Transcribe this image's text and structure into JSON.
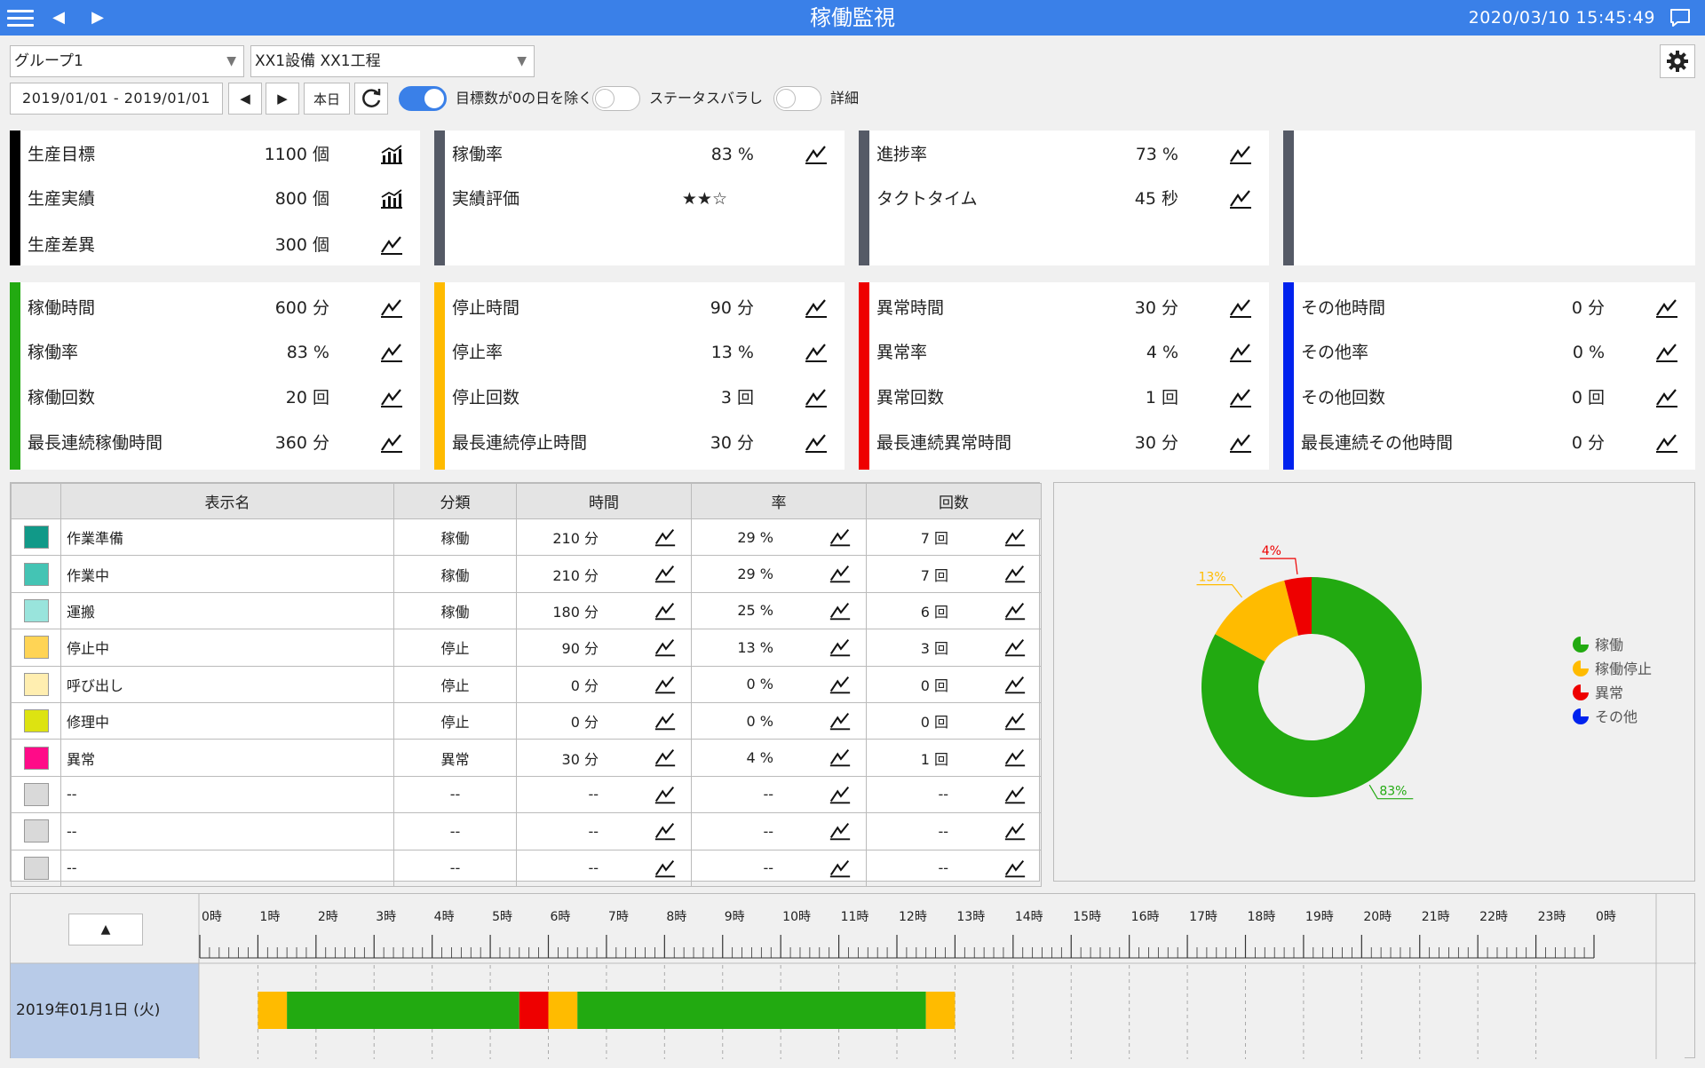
{
  "header": {
    "title": "稼働監視",
    "datetime": "2020/03/10 15:45:49"
  },
  "filters": {
    "group": "グループ1",
    "equipment": "XX1設備 XX1工程",
    "date_range": "2019/01/01  -  2019/01/01",
    "today_label": "本日",
    "toggles": [
      {
        "label": "目標数が0の日を除く",
        "on": true
      },
      {
        "label": "ステータスバラし",
        "on": false
      },
      {
        "label": "詳細",
        "on": false
      }
    ]
  },
  "summary_panels": [
    {
      "bar_color": "#000000",
      "rows": [
        {
          "label": "生産目標",
          "value": "1100 個",
          "icon": "bar-chart-icon"
        },
        {
          "label": "生産実績",
          "value": "800 個",
          "icon": "bar-chart-icon"
        },
        {
          "label": "生産差異",
          "value": "300 個",
          "icon": "trend-line-icon"
        }
      ]
    },
    {
      "bar_color": "#555a66",
      "rows": [
        {
          "label": "稼働率",
          "value": "83 %",
          "icon": "trend-line-icon"
        },
        {
          "label": "実績評価",
          "value": "★★☆",
          "icon": ""
        }
      ]
    },
    {
      "bar_color": "#555a66",
      "rows": [
        {
          "label": "進捗率",
          "value": "73 %",
          "icon": "trend-line-icon"
        },
        {
          "label": "タクトタイム",
          "value": "45 秒",
          "icon": "trend-line-icon"
        }
      ]
    },
    {
      "bar_color": "#555a66",
      "rows": []
    }
  ],
  "status_panels": [
    {
      "bar_color": "#22aa11",
      "rows": [
        {
          "label": "稼働時間",
          "value": "600 分"
        },
        {
          "label": "稼働率",
          "value": "83 %"
        },
        {
          "label": "稼働回数",
          "value": "20 回"
        },
        {
          "label": "最長連続稼働時間",
          "value": "360 分"
        }
      ]
    },
    {
      "bar_color": "#ffbb00",
      "rows": [
        {
          "label": "停止時間",
          "value": "90 分"
        },
        {
          "label": "停止率",
          "value": "13 %"
        },
        {
          "label": "停止回数",
          "value": "3 回"
        },
        {
          "label": "最長連続停止時間",
          "value": "30 分"
        }
      ]
    },
    {
      "bar_color": "#ee0000",
      "rows": [
        {
          "label": "異常時間",
          "value": "30 分"
        },
        {
          "label": "異常率",
          "value": "4 %"
        },
        {
          "label": "異常回数",
          "value": "1 回"
        },
        {
          "label": "最長連続異常時間",
          "value": "30 分"
        }
      ]
    },
    {
      "bar_color": "#0022ee",
      "rows": [
        {
          "label": "その他時間",
          "value": "0 分"
        },
        {
          "label": "その他率",
          "value": "0 %"
        },
        {
          "label": "その他回数",
          "value": "0 回"
        },
        {
          "label": "最長連続その他時間",
          "value": "0 分"
        }
      ]
    }
  ],
  "table": {
    "headers": [
      "表示名",
      "分類",
      "時間",
      "率",
      "回数"
    ],
    "rows": [
      {
        "color": "#119988",
        "name": "作業準備",
        "category": "稼働",
        "time": "210 分",
        "rate": "29 %",
        "count": "7 回"
      },
      {
        "color": "#44c4b4",
        "name": "作業中",
        "category": "稼働",
        "time": "210 分",
        "rate": "29 %",
        "count": "7 回"
      },
      {
        "color": "#99e4dc",
        "name": "運搬",
        "category": "稼働",
        "time": "180 分",
        "rate": "25 %",
        "count": "6 回"
      },
      {
        "color": "#ffd455",
        "name": "停止中",
        "category": "停止",
        "time": "90 分",
        "rate": "13 %",
        "count": "3 回"
      },
      {
        "color": "#ffeeb0",
        "name": "呼び出し",
        "category": "停止",
        "time": "0 分",
        "rate": "0 %",
        "count": "0 回"
      },
      {
        "color": "#dde311",
        "name": "修理中",
        "category": "停止",
        "time": "0 分",
        "rate": "0 %",
        "count": "0 回"
      },
      {
        "color": "#ff0b88",
        "name": "異常",
        "category": "異常",
        "time": "30 分",
        "rate": "4 %",
        "count": "1 回"
      },
      {
        "color": "#d9d9d9",
        "name": "--",
        "category": "--",
        "time": "--",
        "rate": "--",
        "count": "--"
      },
      {
        "color": "#d9d9d9",
        "name": "--",
        "category": "--",
        "time": "--",
        "rate": "--",
        "count": "--"
      },
      {
        "color": "#d9d9d9",
        "name": "--",
        "category": "--",
        "time": "--",
        "rate": "--",
        "count": "--"
      }
    ]
  },
  "chart_data": {
    "type": "pie",
    "donut": true,
    "slices": [
      {
        "name": "稼働",
        "value": 83,
        "label": "83%",
        "color": "#22aa11"
      },
      {
        "name": "稼働停止",
        "value": 13,
        "label": "13%",
        "color": "#ffbb00"
      },
      {
        "name": "異常",
        "value": 4,
        "label": "4%",
        "color": "#ee0000"
      },
      {
        "name": "その他",
        "value": 0,
        "label": "",
        "color": "#0022ee"
      }
    ],
    "legend_placement": "right"
  },
  "timeline": {
    "collapse_label": "▲",
    "hour_labels": [
      "0時",
      "1時",
      "2時",
      "3時",
      "4時",
      "5時",
      "6時",
      "7時",
      "8時",
      "9時",
      "10時",
      "11時",
      "12時",
      "13時",
      "14時",
      "15時",
      "16時",
      "17時",
      "18時",
      "19時",
      "20時",
      "21時",
      "22時",
      "23時",
      "0時"
    ],
    "day_label": "2019年01月1日 (火)",
    "segments": [
      {
        "start_hour": 1.0,
        "end_hour": 1.5,
        "status": "停止",
        "color": "#ffbb00"
      },
      {
        "start_hour": 1.5,
        "end_hour": 5.5,
        "status": "稼働",
        "color": "#22aa11"
      },
      {
        "start_hour": 5.5,
        "end_hour": 6.0,
        "status": "異常",
        "color": "#ee0000"
      },
      {
        "start_hour": 6.0,
        "end_hour": 6.5,
        "status": "停止",
        "color": "#ffbb00"
      },
      {
        "start_hour": 6.5,
        "end_hour": 12.5,
        "status": "稼働",
        "color": "#22aa11"
      },
      {
        "start_hour": 12.5,
        "end_hour": 13.0,
        "status": "停止",
        "color": "#ffbb00"
      }
    ]
  }
}
